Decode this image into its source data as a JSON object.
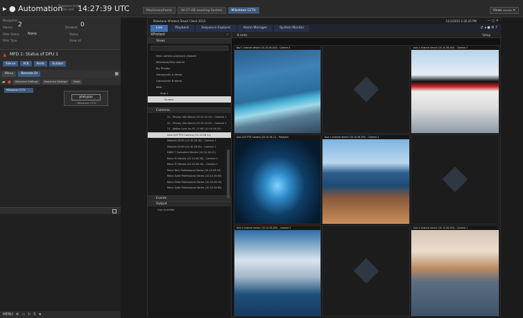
{
  "topbar": {
    "title": "Automation",
    "small_line1": "Sequence Script",
    "small_line2": "1 item sent",
    "clock": "14:27:39 UTC",
    "tabs": [
      "Machineryframe",
      "AV-17-GB Leveling System",
      "Milestone CCTV"
    ],
    "active_tab": 2,
    "views_label": "Views"
  },
  "left": {
    "alarms_label": "Alarms",
    "alarms_value": "2",
    "disabled_label": "Disabled",
    "disabled_value": "0",
    "lab1": "Filter Status",
    "lab1_value": "None",
    "lab2": "Filter Type",
    "lab3": "Status",
    "lab4": "Show all",
    "mfd_title": "MFD 1: Status of DPU 1",
    "mfd_buttons": [
      "Silence",
      "ACK",
      "Alerts",
      "Outdoor"
    ],
    "nav": [
      "Menu",
      "Remote DI"
    ],
    "nav_views": "Views",
    "tool_labels": [
      "Sequence Settings",
      "Sequence Settings"
    ],
    "tree_selected": "Milestone CCTV",
    "device_name": "Milestone CCTV",
    "device_label": "platypus",
    "footer": "MENU"
  },
  "milestone": {
    "title": "Milestone XProtect Smart Client 2014",
    "datetime": "11/1/2015 1:26:45 PM",
    "tabs": [
      "Live",
      "Playback",
      "Sequence Explorer",
      "Alarm Manager",
      "System Monitor"
    ],
    "active_tab": 0,
    "side_header": "XProtect",
    "views_section": "Views",
    "view_items": [
      "New camera playback allowed",
      "Milestone/Ship Admin",
      "My Private",
      "Galaxy/mfc A demo",
      "Galaxy/mfc B demo",
      "Web",
      "Ship 1",
      "Screen"
    ],
    "cameras_section": "Cameras",
    "camera_items": [
      "21 - Privacy Info Demo (10.10.20.10) - Camera 1",
      "20 - Privacy Info Demo (10.10.20.20) - Camera 1",
      "21 - Native Sync Inc PC 17 ME (10.10.26.10)",
      "Axis Q15 PTZ Camera (10.10.26.11)",
      "Mobotix D15D (10.10.26.16) - Camera 1",
      "Mobotix D15D (10.10.26.20) - Camera 1",
      "DWM 7 Controlled Device (10.10.26.21)",
      "Relco Tri Serials (10.10.26.30) - Camera 1",
      "Relco Tri Serials (10.10.26.40) - Camera 1",
      "Relco Tech Professional Series (10.10.26.50)",
      "Relco Suite Professional Series (10.10.26.60)",
      "Relco Suite Professional Series (10.10.26.70)",
      "Relco Suite Professional Series (10.10.26.80)"
    ],
    "selected_camera": 3,
    "events_section": "Events",
    "output_section": "Output",
    "output_item": "Lisa turnstile",
    "view_bar": "8 cams",
    "setup": "Setup",
    "tiles": [
      {
        "caption": "Key 1 channel device (10.10.26.200) - Camera 4",
        "kind": "pool"
      },
      {
        "caption": "",
        "kind": "empty"
      },
      {
        "caption": "Axis 4 channel device (10.10.26.200) - Camera 3",
        "kind": "ship"
      },
      {
        "caption": "Axis Q15 PTZ Camera (10.10.26.11) - Playback",
        "kind": "corridor"
      },
      {
        "caption": "Axis 1 channel device (10.10.26.200) - Camera 2",
        "kind": "deck"
      },
      {
        "caption": "",
        "kind": "empty"
      },
      {
        "caption": "Axis 4 channel device (10.10.26.200) - Camera 5",
        "kind": "top"
      },
      {
        "caption": "",
        "kind": "empty"
      },
      {
        "caption": "Axis 4 channel device (10.10.26.200) - Camera 1",
        "kind": "sunset"
      }
    ]
  },
  "colors": {
    "accent": "#3d5a80",
    "tab_active": "#3f6fb0",
    "background": "#1b1b1b"
  }
}
